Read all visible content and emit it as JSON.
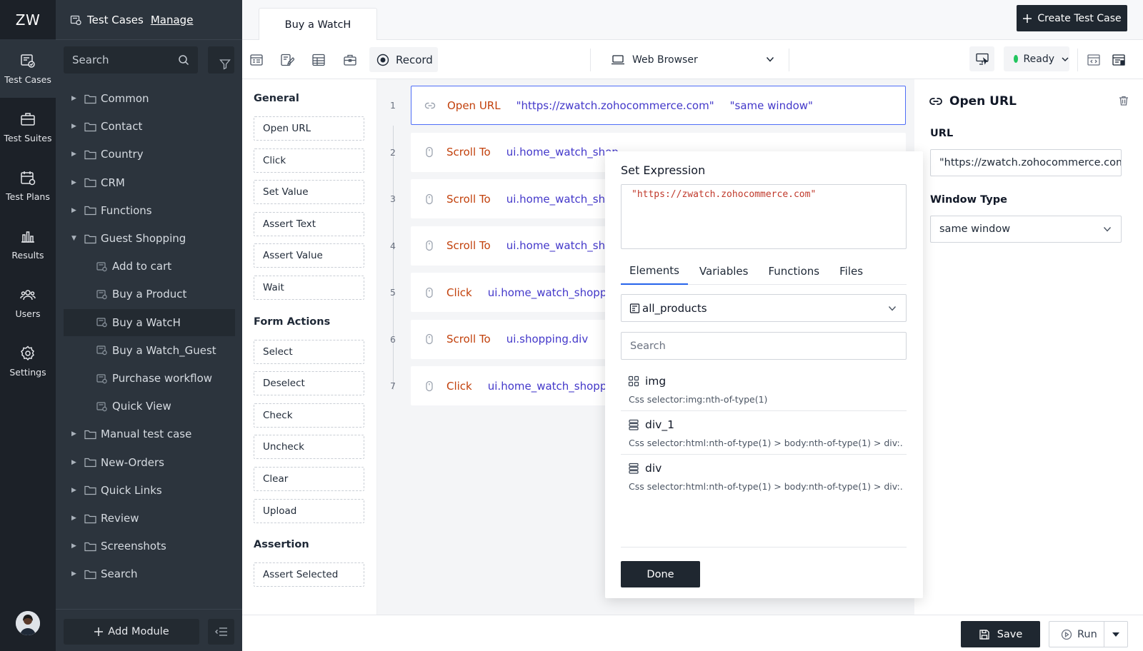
{
  "app": {
    "logo": "ZW"
  },
  "rail": [
    {
      "label": "Test Cases",
      "icon": "test-cases-icon"
    },
    {
      "label": "Test Suites",
      "icon": "test-suites-icon"
    },
    {
      "label": "Test Plans",
      "icon": "test-plans-icon"
    },
    {
      "label": "Results",
      "icon": "results-icon"
    },
    {
      "label": "Users",
      "icon": "users-icon"
    },
    {
      "label": "Settings",
      "icon": "settings-icon"
    }
  ],
  "tree": {
    "title": "Test Cases",
    "manage": "Manage",
    "search_placeholder": "Search",
    "folders_top": [
      "Common",
      "Contact",
      "Country",
      "CRM",
      "Functions"
    ],
    "open_folder": "Guest Shopping",
    "children": [
      "Add to cart",
      "Buy a Product",
      "Buy a WatcH",
      "Buy a Watch_Guest",
      "Purchase workflow",
      "Quick View"
    ],
    "selected_child": "Buy a WatcH",
    "folders_bottom": [
      "Manual test case",
      "New-Orders",
      "Quick Links",
      "Review",
      "Screenshots",
      "Search"
    ],
    "add_module": "Add Module"
  },
  "tab": {
    "label": "Buy a WatcH"
  },
  "create_button": "Create Test Case",
  "toolbar": {
    "record": "Record",
    "browser": "Web Browser",
    "status": "Ready",
    "status_color": "#22c55e"
  },
  "palette": {
    "sections": [
      {
        "title": "General",
        "items": [
          "Open URL",
          "Click",
          "Set Value",
          "Assert Text",
          "Assert Value",
          "Wait"
        ]
      },
      {
        "title": "Form Actions",
        "items": [
          "Select",
          "Deselect",
          "Check",
          "Uncheck",
          "Clear",
          "Upload"
        ]
      },
      {
        "title": "Assertion",
        "items": [
          "Assert Selected"
        ]
      }
    ]
  },
  "steps": [
    {
      "n": "1",
      "cmd": "Open URL",
      "args": [
        "\"https://zwatch.zohocommerce.com\"",
        "\"same window\""
      ]
    },
    {
      "n": "2",
      "cmd": "Scroll To",
      "args": [
        "ui.home_watch_shop"
      ]
    },
    {
      "n": "3",
      "cmd": "Scroll To",
      "args": [
        "ui.home_watch_shop"
      ]
    },
    {
      "n": "4",
      "cmd": "Scroll To",
      "args": [
        "ui.home_watch_shop"
      ]
    },
    {
      "n": "5",
      "cmd": "Click",
      "args": [
        "ui.home_watch_shoppin"
      ]
    },
    {
      "n": "6",
      "cmd": "Scroll To",
      "args": [
        "ui.shopping.div"
      ]
    },
    {
      "n": "7",
      "cmd": "Click",
      "args": [
        "ui.home_watch_shoppin"
      ]
    }
  ],
  "props": {
    "title": "Open URL",
    "url_label": "URL",
    "url_value": "\"https://zwatch.zohocommerce.com\"",
    "window_label": "Window Type",
    "window_value": "same window"
  },
  "expression": {
    "title": "Set Expression",
    "code": "\"https://zwatch.zohocommerce.com\"",
    "tabs": [
      "Elements",
      "Variables",
      "Functions",
      "Files"
    ],
    "active_tab": "Elements",
    "module": "all_products",
    "search_placeholder": "Search",
    "items": [
      {
        "name": "img",
        "selector": "Css selector:img:nth-of-type(1)",
        "icon": "grid-icon"
      },
      {
        "name": "div_1",
        "selector": "Css selector:html:nth-of-type(1) > body:nth-of-type(1) > div:...",
        "icon": "stack-icon"
      },
      {
        "name": "div",
        "selector": "Css selector:html:nth-of-type(1) > body:nth-of-type(1) > div:...",
        "icon": "stack-icon"
      }
    ],
    "done": "Done"
  },
  "bottom": {
    "save": "Save",
    "run": "Run"
  }
}
